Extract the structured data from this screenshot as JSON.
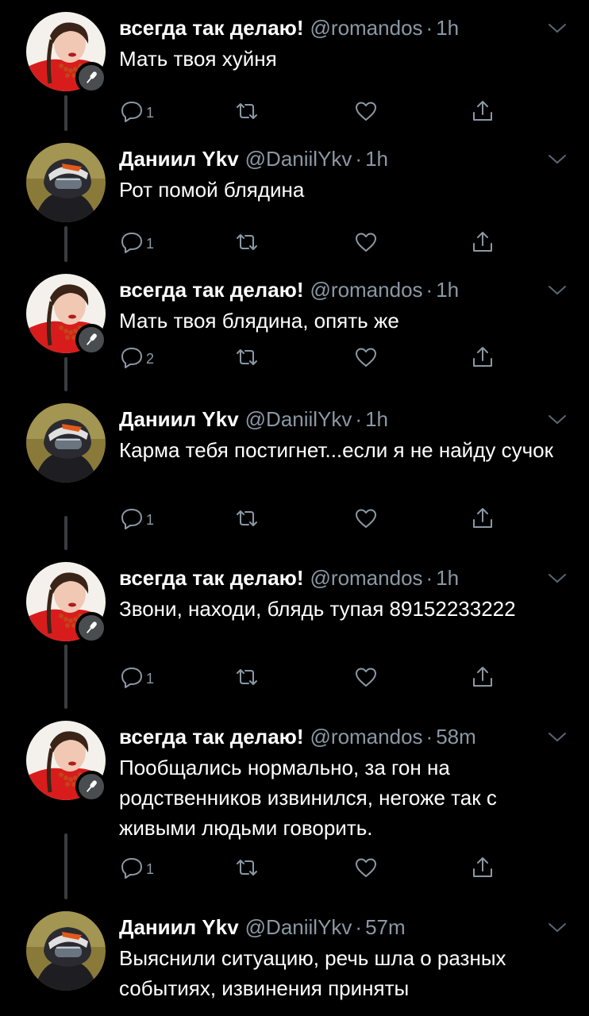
{
  "tweets": [
    {
      "author": "romandos",
      "name": "всегда так делаю!",
      "handle": "@romandos",
      "time": "1h",
      "text": "Мать твоя хуйня",
      "replies": "1",
      "has_badge": true
    },
    {
      "author": "daniil",
      "name": "Даниил Ykv",
      "handle": "@DaniilYkv",
      "time": "1h",
      "text": "Рот помой блядина",
      "replies": "1",
      "has_badge": false
    },
    {
      "author": "romandos",
      "name": "всегда так делаю!",
      "handle": "@romandos",
      "time": "1h",
      "text": "Мать твоя блядина, опять же",
      "replies": "2",
      "has_badge": true
    },
    {
      "author": "daniil",
      "name": "Даниил Ykv",
      "handle": "@DaniilYkv",
      "time": "1h",
      "text": "Карма тебя постигнет...если я не найду сучок",
      "replies": "1",
      "has_badge": false
    },
    {
      "author": "romandos",
      "name": "всегда так делаю!",
      "handle": "@romandos",
      "time": "1h",
      "text": "Звони, находи, блядь тупая 89152233222",
      "replies": "1",
      "has_badge": true
    },
    {
      "author": "romandos",
      "name": "всегда так делаю!",
      "handle": "@romandos",
      "time": "58m",
      "text": "Пообщались нормально, за гон на родственников извинился, негоже так с живыми людьми говорить.",
      "replies": "1",
      "has_badge": true
    },
    {
      "author": "daniil",
      "name": "Даниил Ykv",
      "handle": "@DaniilYkv",
      "time": "57m",
      "text": "Выяснили ситуацию, речь шла о разных событиях, извинения приняты",
      "replies": "",
      "has_badge": false
    }
  ],
  "colors": {
    "background": "#000000",
    "text": "#ffffff",
    "secondary": "#8b98a5",
    "thread_line": "#3a3d40"
  },
  "icons": {
    "reply": "reply-icon",
    "retweet": "retweet-icon",
    "like": "like-icon",
    "share": "share-icon",
    "menu": "chevron-down-icon",
    "badge": "microphone-icon"
  }
}
